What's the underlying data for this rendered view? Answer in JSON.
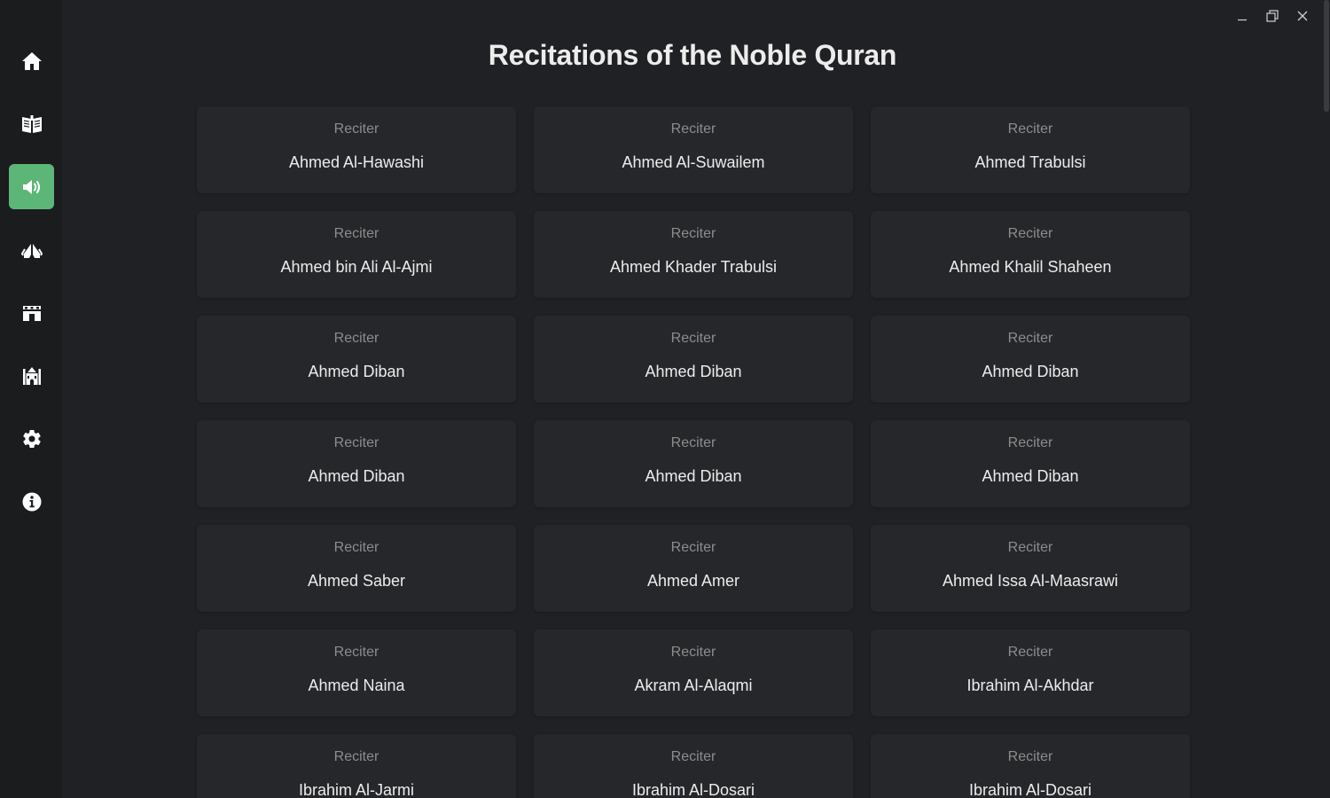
{
  "page": {
    "title": "Recitations of the Noble Quran"
  },
  "sidebar": {
    "items": [
      {
        "icon": "home-icon",
        "active": false
      },
      {
        "icon": "quran-book-icon",
        "active": false
      },
      {
        "icon": "speaker-icon",
        "active": true
      },
      {
        "icon": "praying-hands-icon",
        "active": false
      },
      {
        "icon": "kaaba-icon",
        "active": false
      },
      {
        "icon": "mosque-icon",
        "active": false
      },
      {
        "icon": "gear-icon",
        "active": false
      },
      {
        "icon": "info-icon",
        "active": false
      }
    ],
    "accent_color": "#5cb677"
  },
  "window_controls": {
    "minimize": "minimize-icon",
    "restore": "restore-icon",
    "close": "close-icon"
  },
  "reciters": [
    {
      "label": "Reciter",
      "name": "Ahmed Al-Hawashi"
    },
    {
      "label": "Reciter",
      "name": "Ahmed Al-Suwailem"
    },
    {
      "label": "Reciter",
      "name": "Ahmed Trabulsi"
    },
    {
      "label": "Reciter",
      "name": "Ahmed bin Ali Al-Ajmi"
    },
    {
      "label": "Reciter",
      "name": "Ahmed Khader Trabulsi"
    },
    {
      "label": "Reciter",
      "name": "Ahmed Khalil Shaheen"
    },
    {
      "label": "Reciter",
      "name": "Ahmed Diban"
    },
    {
      "label": "Reciter",
      "name": "Ahmed Diban"
    },
    {
      "label": "Reciter",
      "name": "Ahmed Diban"
    },
    {
      "label": "Reciter",
      "name": "Ahmed Diban"
    },
    {
      "label": "Reciter",
      "name": "Ahmed Diban"
    },
    {
      "label": "Reciter",
      "name": "Ahmed Diban"
    },
    {
      "label": "Reciter",
      "name": "Ahmed Saber"
    },
    {
      "label": "Reciter",
      "name": "Ahmed Amer"
    },
    {
      "label": "Reciter",
      "name": "Ahmed Issa Al-Maasrawi"
    },
    {
      "label": "Reciter",
      "name": "Ahmed Naina"
    },
    {
      "label": "Reciter",
      "name": "Akram Al-Alaqmi"
    },
    {
      "label": "Reciter",
      "name": "Ibrahim Al-Akhdar"
    },
    {
      "label": "Reciter",
      "name": "Ibrahim Al-Jarmi"
    },
    {
      "label": "Reciter",
      "name": "Ibrahim Al-Dosari"
    },
    {
      "label": "Reciter",
      "name": "Ibrahim Al-Dosari"
    }
  ]
}
